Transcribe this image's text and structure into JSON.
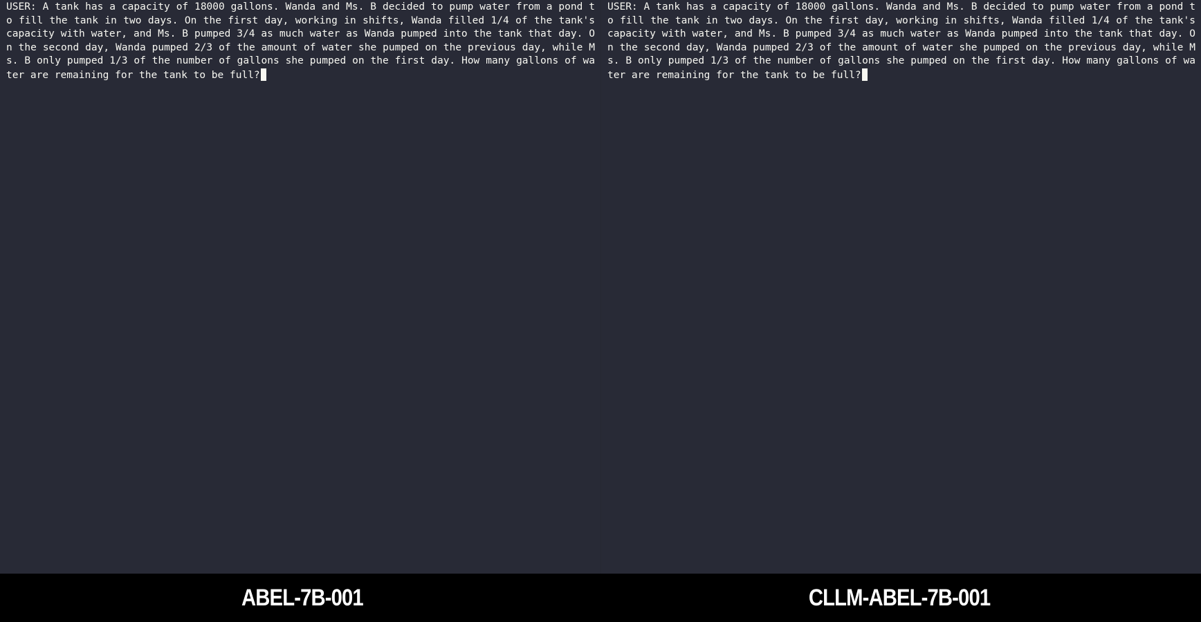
{
  "panes": [
    {
      "model": "ABEL-7B-001",
      "terminal_text": "USER: A tank has a capacity of 18000 gallons. Wanda and Ms. B decided to pump water from a pond to fill the tank in two days. On the first day, working in shifts, Wanda filled 1/4 of the tank's capacity with water, and Ms. B pumped 3/4 as much water as Wanda pumped into the tank that day. On the second day, Wanda pumped 2/3 of the amount of water she pumped on the previous day, while Ms. B only pumped 1/3 of the number of gallons she pumped on the first day. How many gallons of water are remaining for the tank to be full?"
    },
    {
      "model": "CLLM-ABEL-7B-001",
      "terminal_text": "USER: A tank has a capacity of 18000 gallons. Wanda and Ms. B decided to pump water from a pond to fill the tank in two days. On the first day, working in shifts, Wanda filled 1/4 of the tank's capacity with water, and Ms. B pumped 3/4 as much water as Wanda pumped into the tank that day. On the second day, Wanda pumped 2/3 of the amount of water she pumped on the previous day, while Ms. B only pumped 1/3 of the number of gallons she pumped on the first day. How many gallons of water are remaining for the tank to be full?"
    }
  ],
  "colors": {
    "terminal_background": "#282a36",
    "terminal_text": "#f8f8f2",
    "caption_background": "#000000",
    "caption_text": "#ffffff"
  }
}
